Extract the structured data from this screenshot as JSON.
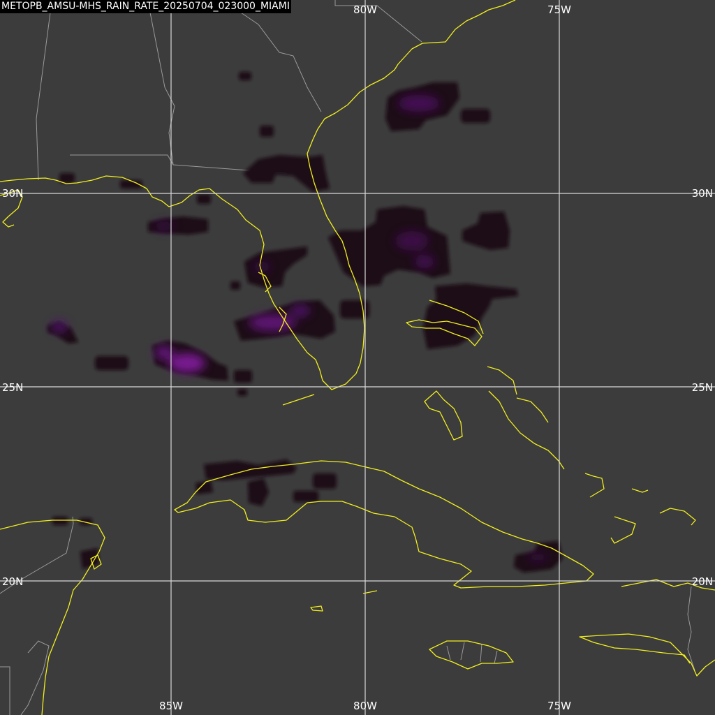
{
  "title": "METOPB_AMSU-MHS_RAIN_RATE_20250704_023000_MIAMI",
  "longitude_labels": {
    "top": [
      "80W",
      "75W"
    ],
    "bottom": [
      "85W",
      "80W",
      "75W"
    ]
  },
  "latitude_labels": {
    "left": [
      "30N",
      "25N",
      "20N"
    ],
    "right": [
      "30N",
      "25N",
      "20N"
    ]
  },
  "colors": {
    "background": "#3c3c3c",
    "coastline": "#f2ef1e",
    "borders": "#9a9a9a",
    "gridlines": "#d9d9d9",
    "rain_dark": "#1a0816",
    "rain_light": "#8a1ca8"
  }
}
